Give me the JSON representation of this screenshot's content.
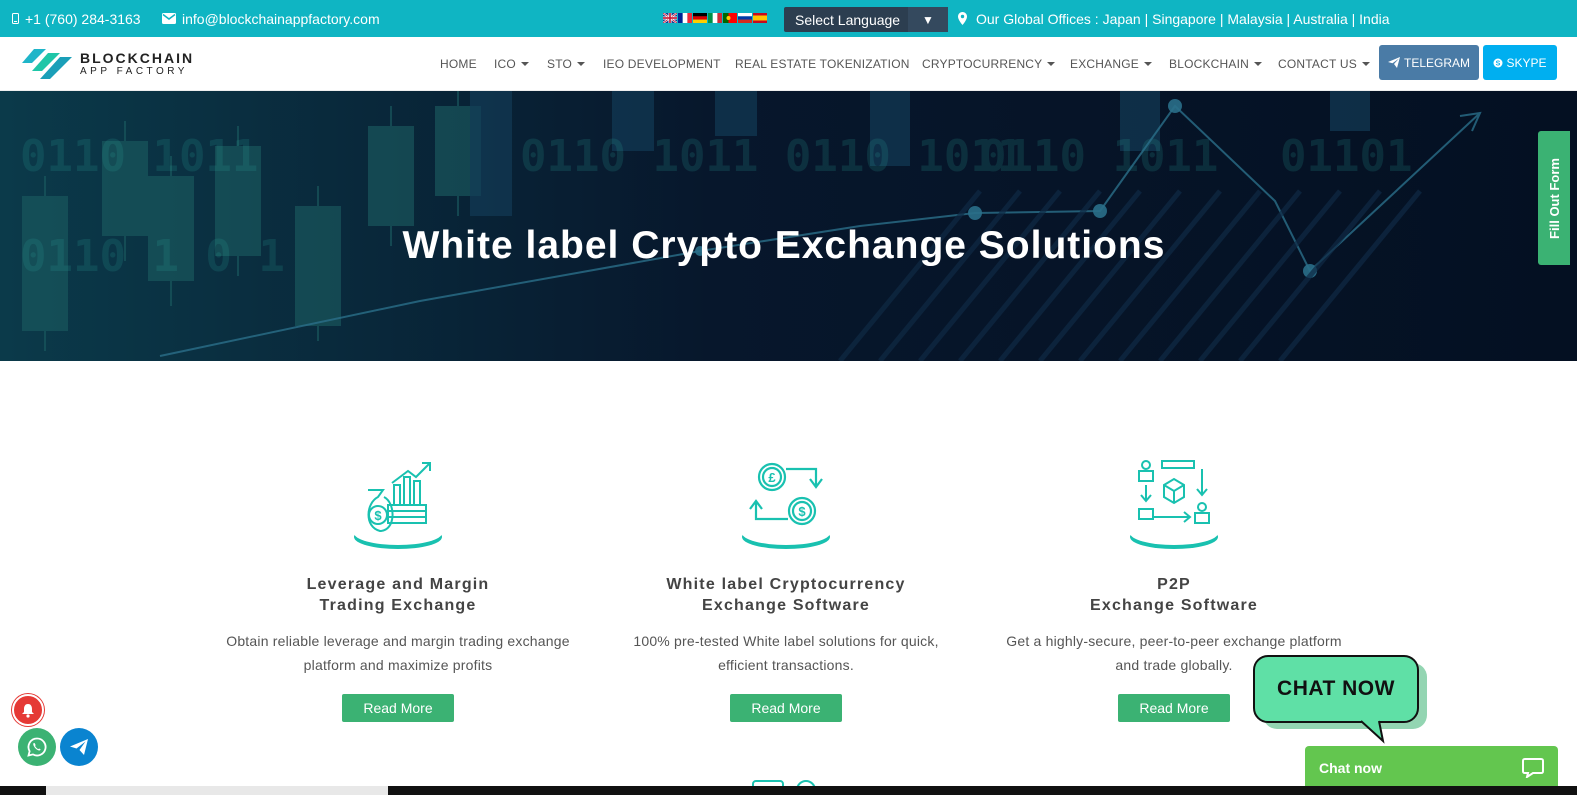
{
  "topbar": {
    "phone": "+1 (760) 284-3163",
    "email": "info@blockchainappfactory.com",
    "language_select": "Select Language",
    "offices": "Our Global Offices : Japan | Singapore | Malaysia | Australia | India",
    "flags": [
      "gb-flag",
      "fr-flag",
      "de-flag",
      "it-flag",
      "pt-flag",
      "ru-flag",
      "es-flag"
    ]
  },
  "logo": {
    "line1": "BLOCKCHAIN",
    "line2": "APP FACTORY"
  },
  "nav": {
    "home": "HOME",
    "ico": "ICO",
    "sto": "STO",
    "ieo": "IEO DEVELOPMENT",
    "real_estate": "REAL ESTATE TOKENIZATION",
    "crypto": "CRYPTOCURRENCY",
    "exchange": "EXCHANGE",
    "blockchain": "BLOCKCHAIN",
    "contact": "CONTACT US",
    "telegram": "TELEGRAM",
    "skype": "SKYPE"
  },
  "hero": {
    "title": "White label Crypto Exchange Solutions",
    "side_tab": "Fill Out Form"
  },
  "cards": [
    {
      "icon": "money-bag-chart-icon",
      "title_line1": "Leverage and Margin",
      "title_line2": "Trading Exchange",
      "desc_line1": "Obtain reliable leverage and margin trading exchange",
      "desc_line2": "platform and maximize profits",
      "button": "Read More"
    },
    {
      "icon": "currency-exchange-icon",
      "title_line1": "White label Cryptocurrency",
      "title_line2": "Exchange Software",
      "desc_line1": "100% pre-tested White label solutions for quick,",
      "desc_line2": "efficient transactions.",
      "button": "Read More"
    },
    {
      "icon": "p2p-transfer-icon",
      "title_line1": "P2P",
      "title_line2": "Exchange Software",
      "desc_line1": "Get a highly-secure, peer-to-peer exchange platform",
      "desc_line2": "and trade globally.",
      "button": "Read More"
    }
  ],
  "chat": {
    "bubble": "CHAT NOW",
    "bar": "Chat now"
  },
  "colors": {
    "teal": "#0fb5c3",
    "green": "#3bb273",
    "icon_teal": "#19c1b0",
    "hero_bg": "#071426"
  }
}
